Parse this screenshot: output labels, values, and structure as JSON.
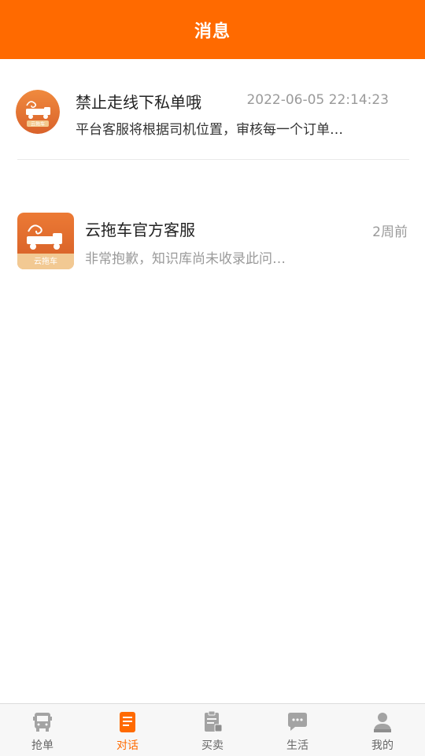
{
  "header": {
    "title": "消息"
  },
  "messages": [
    {
      "title": "禁止走线下私单哦",
      "time": "2022-06-05 22:14:23",
      "preview": "平台客服将根据司机位置，审核每一个订单…"
    },
    {
      "title": "云拖车官方客服",
      "time": "2周前",
      "preview": "非常抱歉，知识库尚未收录此问…"
    }
  ],
  "avatar_text": "云拖车",
  "tabs": [
    {
      "label": "抢单",
      "icon": "bus-icon",
      "active": false
    },
    {
      "label": "对话",
      "icon": "document-icon",
      "active": true
    },
    {
      "label": "买卖",
      "icon": "clipboard-icon",
      "active": false
    },
    {
      "label": "生活",
      "icon": "chat-bubble-icon",
      "active": false
    },
    {
      "label": "我的",
      "icon": "person-icon",
      "active": false
    }
  ],
  "colors": {
    "brand": "#ff6a00",
    "tab_inactive": "#9a9a9a"
  }
}
